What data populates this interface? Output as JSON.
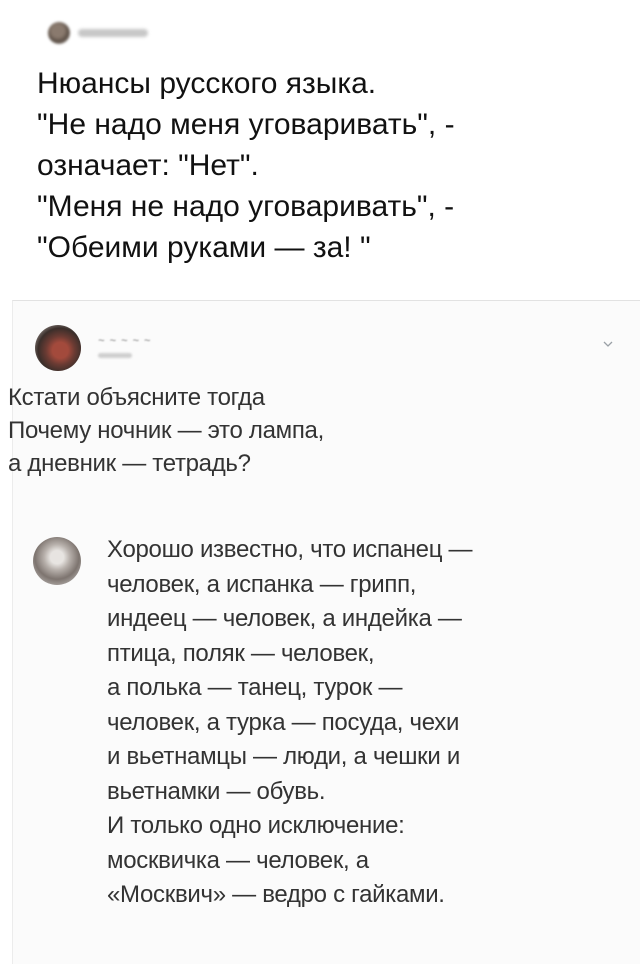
{
  "post": {
    "lines": [
      "Нюансы русского языка.",
      "\"Не надо меня уговаривать\", -",
      "означает: \"Нет\".",
      "\"Меня не надо уговаривать\", -",
      "\"Обеими руками — за! \""
    ]
  },
  "comment1": {
    "body_lines": [
      "Кстати объясните тогда",
      "Почему ночник — это лампа,",
      "а дневник — тетрадь?"
    ]
  },
  "comment2": {
    "body_lines": [
      "Хорошо известно, что испанец —",
      "человек, а испанка — грипп,",
      "индеец — человек, а индейка —",
      "птица, поляк — человек,",
      "а полька — танец, турок —",
      "человек, а турка — посуда, чехи",
      "и вьетнамцы — люди, а чешки и",
      "вьетнамки — обувь.",
      "И только одно исключение:",
      "москвичка — человек, а",
      "«Москвич» — ведро с гайками."
    ]
  },
  "icons": {
    "chevron": "chevron-down-icon"
  }
}
